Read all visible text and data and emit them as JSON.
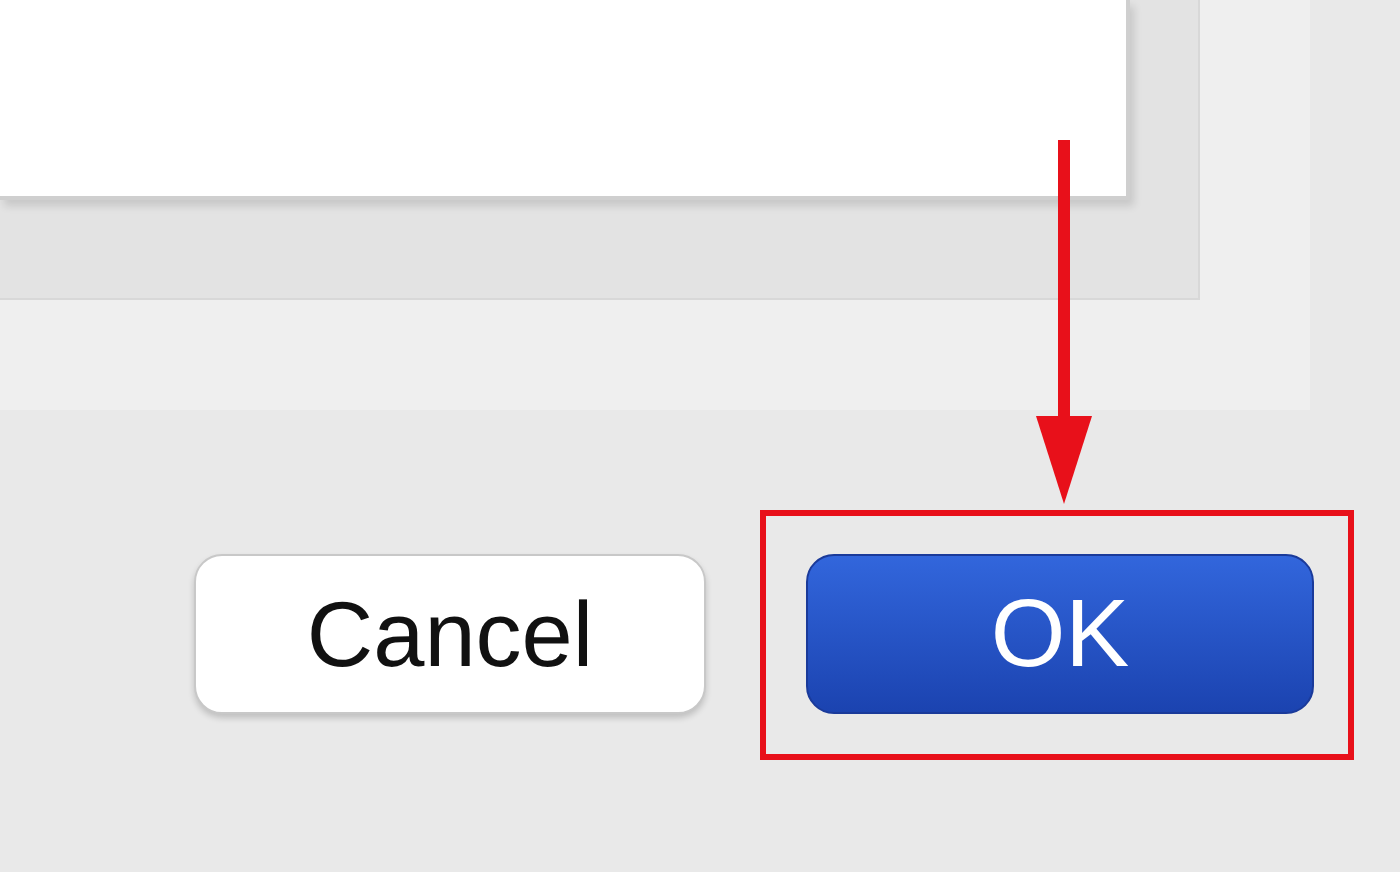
{
  "buttons": [
    {
      "label": "Cancel",
      "kind": "secondary",
      "highlighted": false
    },
    {
      "label": "OK",
      "kind": "default",
      "highlighted": true
    }
  ]
}
